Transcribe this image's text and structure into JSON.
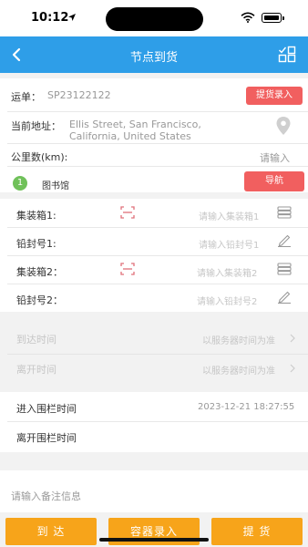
{
  "status": {
    "time": "10:12"
  },
  "nav": {
    "title": "节点到货"
  },
  "waybill": {
    "label": "运单：",
    "number": "SP23122122",
    "action": "提货录入"
  },
  "address": {
    "label": "当前地址：",
    "line1": "Ellis Street, San Francisco,",
    "line2": "California, United States"
  },
  "distance": {
    "label": "公里数(km):",
    "placeholder": "请输入"
  },
  "node": {
    "index": "1",
    "name": "图书馆",
    "nav_button": "导航"
  },
  "fields": [
    {
      "label": "集装箱1:",
      "placeholder": "请输入集装箱1"
    },
    {
      "label": "铅封号1:",
      "placeholder": "请输入铅封号1"
    },
    {
      "label": "集装箱2：",
      "placeholder": "请输入集装箱2"
    },
    {
      "label": "铅封号2：",
      "placeholder": "请输入铅封号2"
    }
  ],
  "times": {
    "arrive_label": "到达时间",
    "arrive_hint": "以服务器时间为准",
    "leave_label": "离开时间",
    "leave_hint": "以服务器时间为准"
  },
  "fence": {
    "enter_label": "进入围栏时间",
    "enter_value": "2023-12-21 18:27:55",
    "exit_label": "离开围栏时间",
    "exit_value": ""
  },
  "remark": {
    "placeholder": "请输入备注信息"
  },
  "bottom": {
    "arrive": "到 达",
    "container": "容器录入",
    "pickup": "提 货"
  },
  "colors": {
    "nav": "#2e9ee8",
    "accent_red": "#f15f5f",
    "badge_green": "#70c15a",
    "bottom_orange": "#f7a41a"
  }
}
